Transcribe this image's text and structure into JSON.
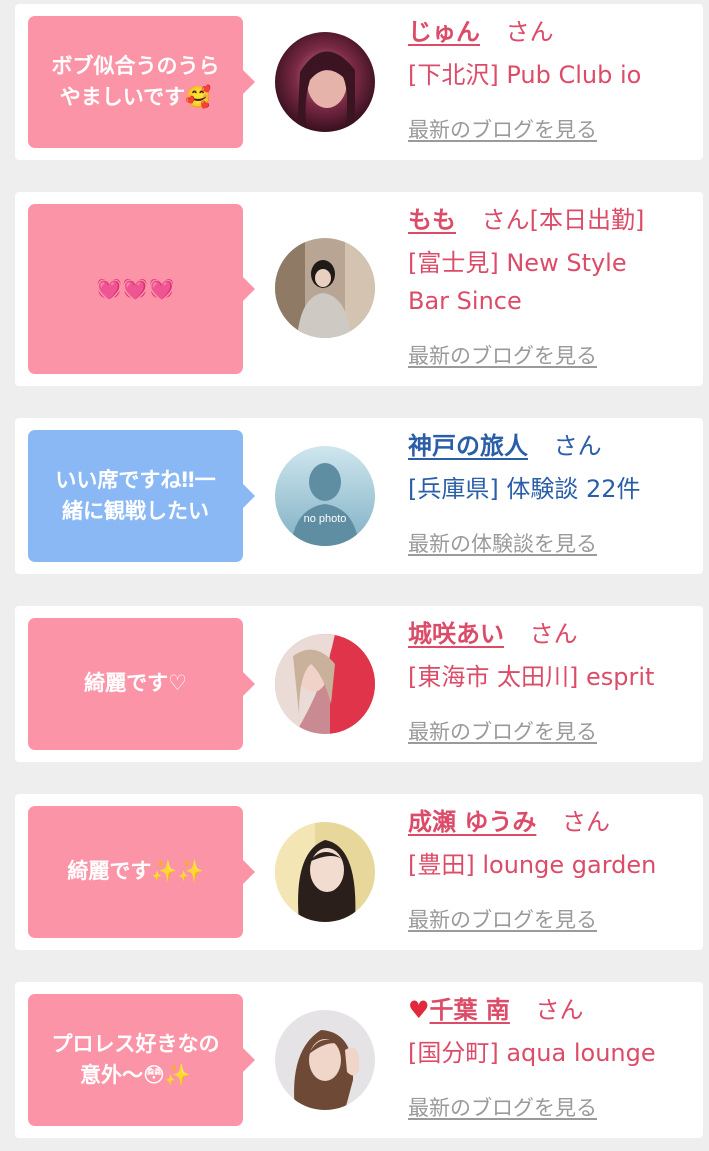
{
  "cards": [
    {
      "bubble": "ボブ似合うのうら\nやましいです🥰",
      "bubble_color": "#fb94a7",
      "name": "じゅん",
      "suffix": "さん",
      "status": "",
      "shop": "[下北沢] Pub Club io",
      "more": "最新のブログを見る",
      "text_color": "#dc4c69"
    },
    {
      "bubble": "💓💓💓",
      "bubble_color": "#fb94a7",
      "name": "もも",
      "suffix": "さん",
      "status": "[本日出勤]",
      "shop": "[富士見] New Style Bar Since",
      "more": "最新のブログを見る",
      "text_color": "#dc4c69"
    },
    {
      "bubble": "いい席ですね‼︎一\n緒に観戦したい",
      "bubble_color": "#8ab8f5",
      "name": "神戸の旅人",
      "suffix": "さん",
      "status": "",
      "shop": "[兵庫県] 体験談 22件",
      "more": "最新の体験談を見る",
      "avatar_label": "no photo",
      "text_color": "#2a5ea8"
    },
    {
      "bubble": "綺麗です♡",
      "bubble_color": "#fb94a7",
      "name": "城咲あい",
      "suffix": "さん",
      "status": "",
      "shop": "[東海市 太田川] esprit",
      "more": "最新のブログを見る",
      "text_color": "#dc4c69"
    },
    {
      "bubble": "綺麗です✨✨",
      "bubble_color": "#fb94a7",
      "name": "成瀬 ゆうみ",
      "suffix": "さん",
      "status": "",
      "shop": "[豊田] lounge garden",
      "more": "最新のブログを見る",
      "text_color": "#dc4c69"
    },
    {
      "bubble": "プロレス好きなの\n意外〜😳✨",
      "bubble_color": "#fb94a7",
      "name_icon": "heart-icon",
      "name": "千葉 南",
      "suffix": "さん",
      "status": "",
      "shop": "[国分町] aqua lounge",
      "more": "最新のブログを見る",
      "text_color": "#dc4c69"
    }
  ]
}
